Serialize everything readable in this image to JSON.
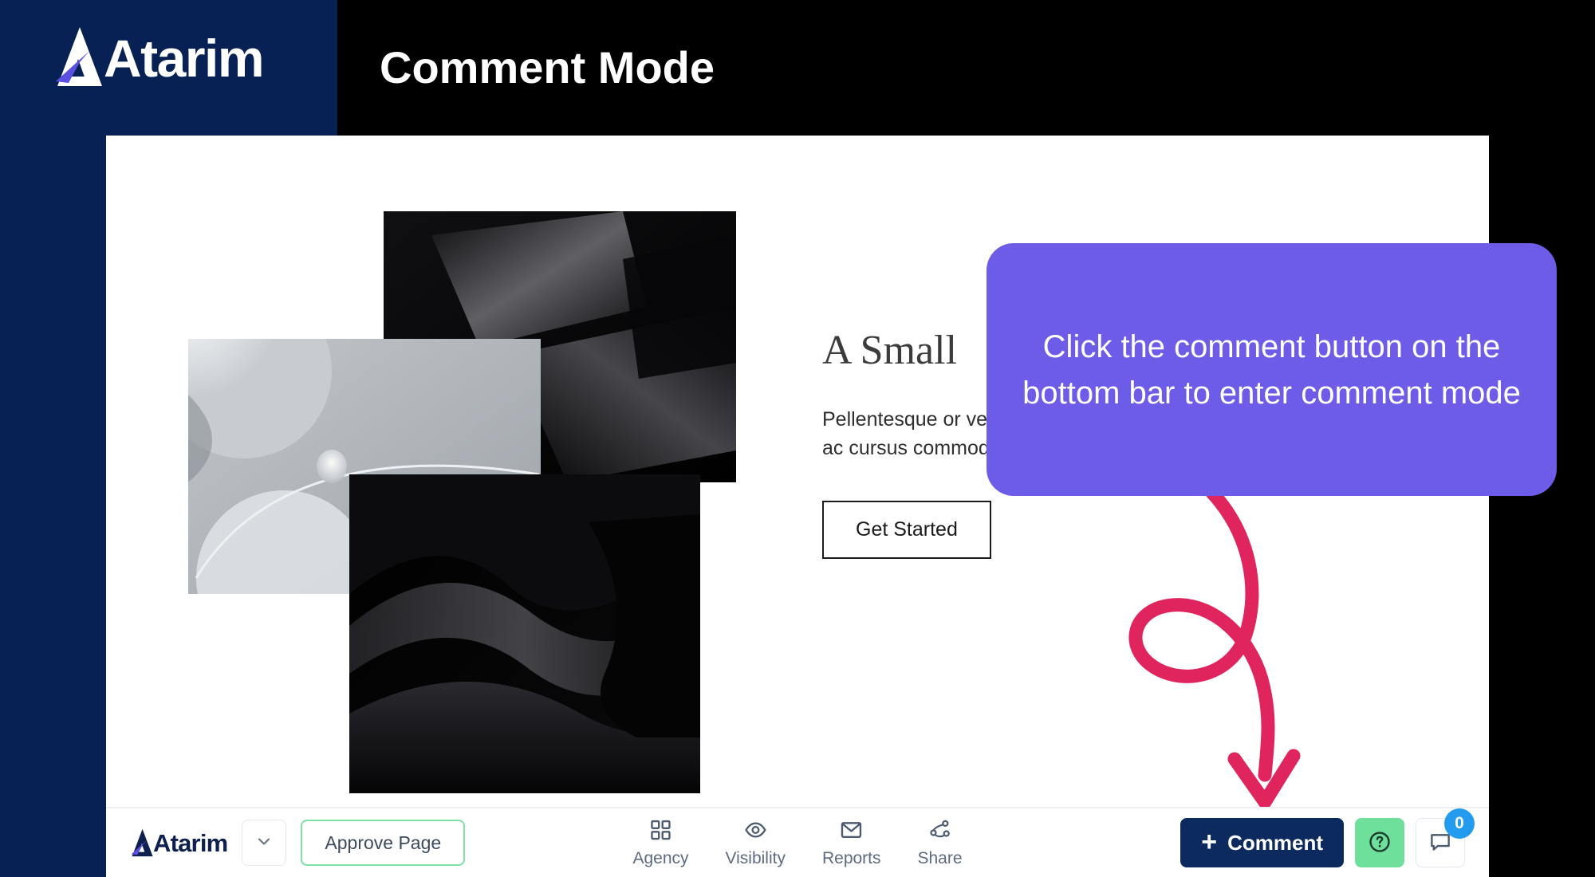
{
  "header": {
    "brand": "Atarim",
    "title": "Comment Mode",
    "logo_icon": "atarim-logo-icon"
  },
  "colors": {
    "navy": "#072154",
    "black": "#000000",
    "purple_callout": "#6c5ce7",
    "pink_arrow": "#e0245e",
    "green_approve_border": "#7ee2a8",
    "green_help": "#6ee09b",
    "blue_badge": "#239cf0",
    "comment_button": "#0d2a5e"
  },
  "callout": {
    "text": "Click the comment button on the bottom bar to enter comment mode"
  },
  "annotation": {
    "arrow_icon": "curved-loop-arrow-icon"
  },
  "page_content": {
    "collage": [
      {
        "name": "abstract-dark-geometry-image"
      },
      {
        "name": "gray-water-droplet-image"
      },
      {
        "name": "dark-wave-abstract-image"
      }
    ],
    "heading": "A Small",
    "paragraph": "Pellentesque or\nvestibulum. Etiam\neuismod. Fusce dapibus, tellus ac cursus commod.",
    "cta_label": "Get Started"
  },
  "bottom_bar": {
    "brand": "Atarim",
    "logo_icon": "atarim-logo-icon",
    "dropdown_icon": "chevron-down-icon",
    "approve_label": "Approve Page",
    "tools": [
      {
        "label": "Agency",
        "icon": "grid-icon"
      },
      {
        "label": "Visibility",
        "icon": "eye-icon"
      },
      {
        "label": "Reports",
        "icon": "envelope-icon"
      },
      {
        "label": "Share",
        "icon": "share-nodes-icon"
      }
    ],
    "comment_label": "Comment",
    "comment_plus_icon": "plus-icon",
    "help_icon": "question-circle-icon",
    "chat_icon": "chat-bubble-icon",
    "chat_badge_count": "0"
  }
}
